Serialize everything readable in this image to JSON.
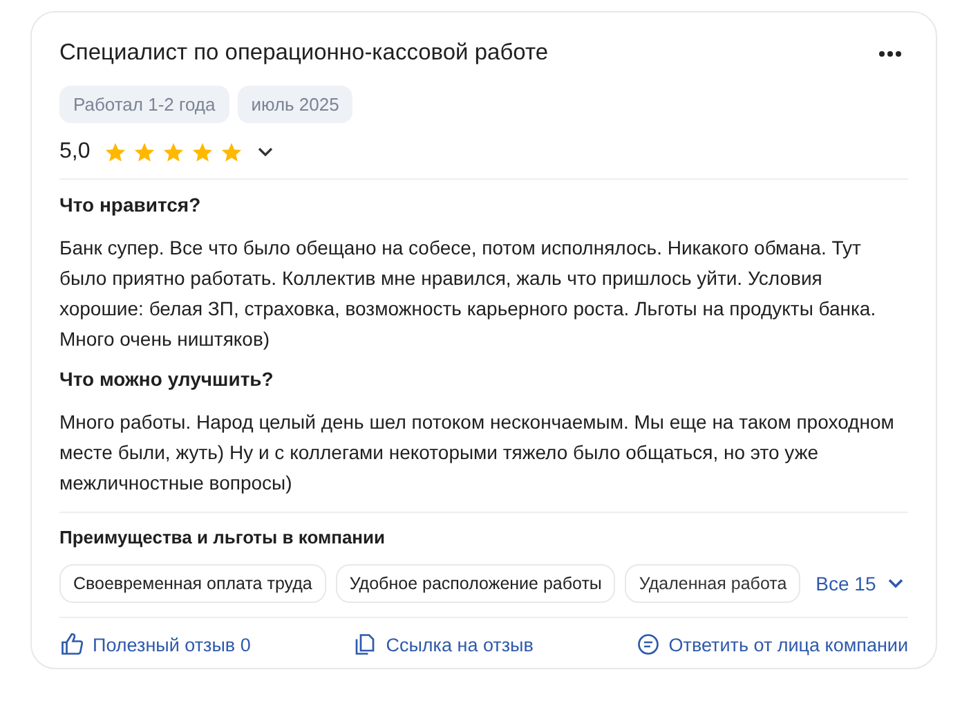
{
  "review": {
    "title": "Специалист по операционно-кассовой работе",
    "tags": [
      "Работал 1-2 года",
      "июль 2025"
    ],
    "rating": "5,0",
    "stars": 5,
    "sections": [
      {
        "heading": "Что нравится?",
        "text": "Банк супер. Все что было обещано на собесе, потом исполнялось. Никакого обмана. Тут было приятно работать. Коллектив мне нравился, жаль что пришлось уйти. Условия хорошие: белая ЗП, страховка, возможность карьерного роста. Льготы на продукты банка. Много очень ништяков)"
      },
      {
        "heading": "Что можно улучшить?",
        "text": "Много работы. Народ целый день шел потоком нескончаемым. Мы еще на таком проходном месте были, жуть) Ну и с коллегами некоторыми тяжело было общаться, но это уже межличностные вопросы)"
      }
    ],
    "benefits": {
      "heading": "Преимущества и льготы в компании",
      "items": [
        "Своевременная оплата труда",
        "Удобное расположение работы",
        "Удаленная работа"
      ],
      "more": "Все 15"
    },
    "actions": [
      {
        "kind": "like",
        "label": "Полезный отзыв 0"
      },
      {
        "kind": "link",
        "label": "Ссылка на отзыв"
      },
      {
        "kind": "reply",
        "label": "Ответить от лица компании"
      }
    ]
  }
}
